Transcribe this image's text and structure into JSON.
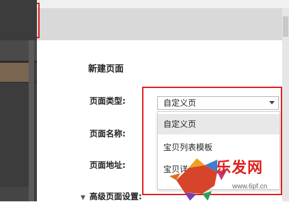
{
  "toolbar": {
    "add_label": "+"
  },
  "form": {
    "title": "新建页面",
    "page_type_label": "页面类型:",
    "page_name_label": "页面名称:",
    "page_address_label": "页面地址:",
    "advanced_label": "高级页面设置:"
  },
  "page_type_select": {
    "selected": "自定义页",
    "options": [
      "自定义页",
      "宝贝列表模板",
      "宝贝详情模板"
    ],
    "partial_option_text": "宝贝详"
  },
  "watermark": {
    "brand": "乐发网",
    "site": "www.6pf.cn"
  },
  "colors": {
    "highlight_frame": "#e02020",
    "sidebar": "#3c3c3c",
    "watermark_text": "#e0201c"
  }
}
